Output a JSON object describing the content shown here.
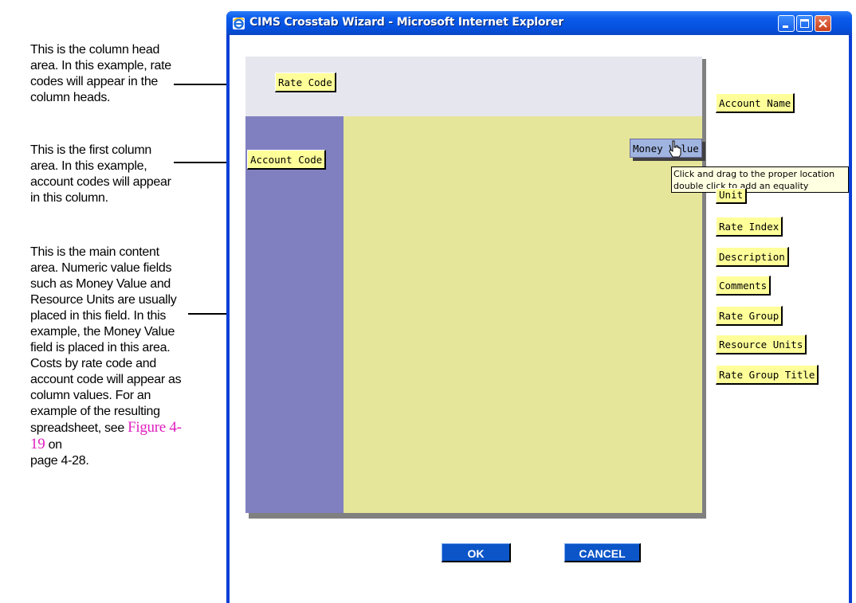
{
  "annotations": {
    "column_head": "This is the column head area. In this example, rate codes will appear in the column heads.",
    "first_column": "This is the first column area. In this example, account codes will appear in this column.",
    "main_content_text": "This is the main content area. Numeric value fields such as Money Value and Resource Units are usually placed in this field. In this example, the Money Value field is placed in this area. Costs by rate code and account code will appear as column values. For an example of the resulting spreadsheet, see",
    "figure_ref": "Figure 4-19",
    "on_text": "on",
    "page_ref": "page 4-28."
  },
  "window": {
    "title": "CIMS Crosstab Wizard - Microsoft Internet Explorer",
    "icon": "ie-icon"
  },
  "zones": {
    "column_head_field": "Rate Code",
    "first_column_field": "Account Code",
    "dragging_field": "Money Value"
  },
  "tooltip": {
    "line1": "Click and drag to the proper location",
    "line2": "double click to add an equality"
  },
  "available_fields": [
    "Account Name",
    "Unit",
    "Rate Index",
    "Description",
    "Comments",
    "Rate Group",
    "Resource Units",
    "Rate Group Title"
  ],
  "buttons": {
    "ok": "OK",
    "cancel": "CANCEL"
  },
  "colors": {
    "titlebar": "#0551e0",
    "column_head_area": "#e6e6ef",
    "first_column_area": "#8080c0",
    "main_area": "#e6e69a",
    "field": "#ffff99",
    "button": "#0b55c8",
    "figure_ref": "#e020c0"
  }
}
